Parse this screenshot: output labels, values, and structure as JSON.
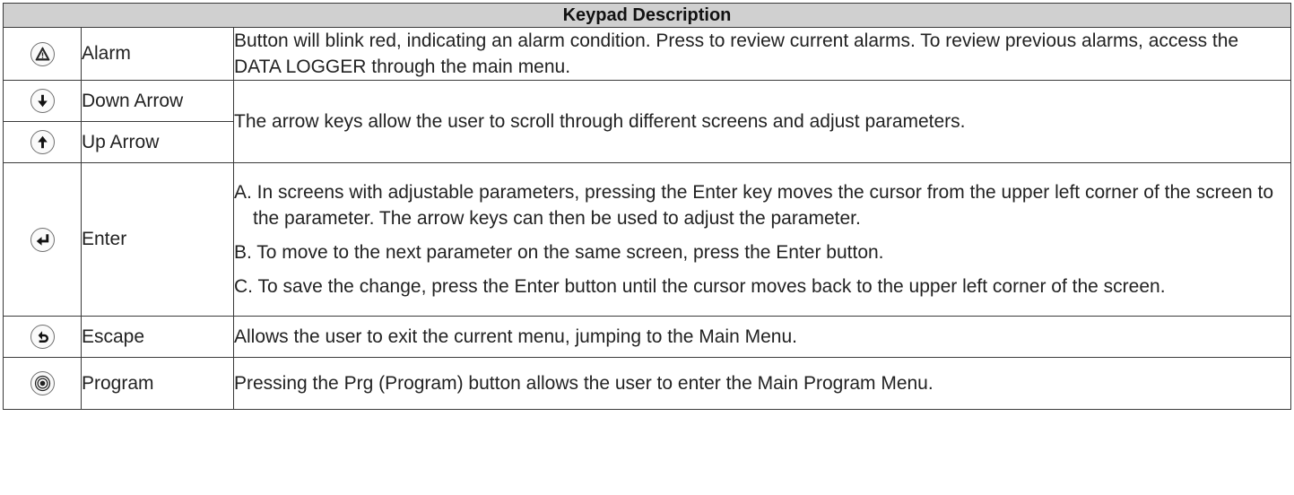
{
  "table": {
    "title": "Keypad Description",
    "rows": {
      "alarm": {
        "icon": "alarm-triangle-icon",
        "name": "Alarm",
        "description": "Button will blink red, indicating an alarm condition. Press to review current alarms. To review previous alarms, access the DATA LOGGER through the main menu."
      },
      "down": {
        "icon": "arrow-down-icon",
        "name": "Down Arrow"
      },
      "up": {
        "icon": "arrow-up-icon",
        "name": "Up Arrow"
      },
      "arrows_description": "The arrow keys allow the user to scroll through different screens and adjust parameters.",
      "enter": {
        "icon": "enter-return-icon",
        "name": "Enter",
        "items": [
          "A. In screens with adjustable parameters, pressing the Enter key moves the cursor from the upper left corner of the screen to the parameter. The arrow keys can then be used to adjust the parameter.",
          "B. To move to the next parameter on the same screen, press the Enter button.",
          "C. To save the change, press the Enter button until the cursor moves back to the upper left corner of the screen."
        ]
      },
      "escape": {
        "icon": "escape-back-icon",
        "name": "Escape",
        "description": "Allows the user to exit the current menu, jumping to the Main Menu."
      },
      "program": {
        "icon": "program-rings-icon",
        "name": "Program",
        "description": "Pressing the Prg (Program) button allows the user to enter the Main Program Menu."
      }
    }
  }
}
